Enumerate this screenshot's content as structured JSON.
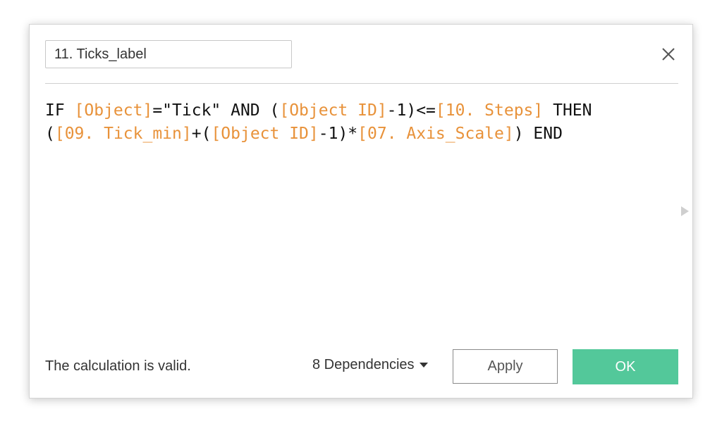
{
  "dialog": {
    "name_value": "11. Ticks_label",
    "close_icon": "close-icon",
    "formula_lines": [
      [
        {
          "t": "IF ",
          "ref": false
        },
        {
          "t": "[Object]",
          "ref": true
        },
        {
          "t": "=\"Tick\" AND (",
          "ref": false
        },
        {
          "t": "[Object ID]",
          "ref": true
        },
        {
          "t": "-1)<=",
          "ref": false
        },
        {
          "t": "[10. Steps]",
          "ref": true
        },
        {
          "t": " THEN",
          "ref": false
        }
      ],
      [
        {
          "t": "(",
          "ref": false
        },
        {
          "t": "[09. Tick_min]",
          "ref": true
        },
        {
          "t": "+(",
          "ref": false
        },
        {
          "t": "[Object ID]",
          "ref": true
        },
        {
          "t": "-1)*",
          "ref": false
        },
        {
          "t": "[07. Axis_Scale]",
          "ref": true
        },
        {
          "t": ") END",
          "ref": false
        }
      ]
    ],
    "status": "The calculation is valid.",
    "dependencies_label": "8 Dependencies",
    "apply_label": "Apply",
    "ok_label": "OK"
  },
  "colors": {
    "field_reference": "#e8923a",
    "ok_button": "#53c89a"
  }
}
